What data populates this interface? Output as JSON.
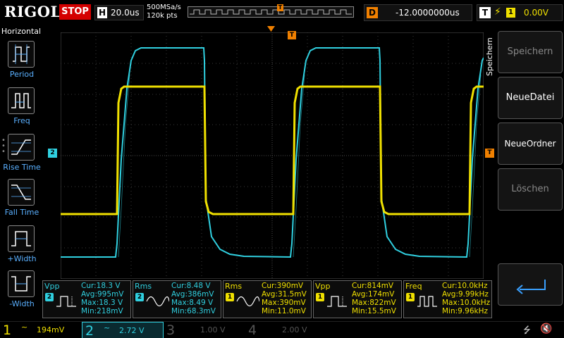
{
  "brand": "RIGOL",
  "run_state": "STOP",
  "timebase": {
    "letter": "H",
    "value": "20.0us"
  },
  "sample": {
    "rate": "500MSa/s",
    "depth": "120k pts"
  },
  "memory_trigger_label": "T",
  "delay": {
    "letter": "D",
    "value": "-12.0000000us"
  },
  "trigger": {
    "letter": "T",
    "edge": "⚡",
    "source": "1",
    "level": "0.00V"
  },
  "left_menu": {
    "title": "Horizontal",
    "items": [
      {
        "label": "Period"
      },
      {
        "label": "Freq"
      },
      {
        "label": "Rise Time"
      },
      {
        "label": "Fall Time"
      },
      {
        "label": "+Width"
      },
      {
        "label": "-Width"
      }
    ]
  },
  "right_menu": {
    "title": "Speichern",
    "buttons": [
      {
        "label": "Speichern",
        "enabled": false
      },
      {
        "label": "NeueDatei",
        "enabled": true
      },
      {
        "label": "NeueOrdner",
        "enabled": true
      },
      {
        "label": "Löschen",
        "enabled": false
      }
    ],
    "back_icon": "return-arrow-icon"
  },
  "markers": {
    "ch2": "2",
    "trigger_T": "T"
  },
  "measurements": [
    {
      "name": "Vpp",
      "src": "2",
      "cur": "Cur:18.3 V",
      "avg": "Avg:995mV",
      "max": "Max:18.3 V",
      "min": "Min:218mV",
      "color": "#30d0e0"
    },
    {
      "name": "Rms",
      "src": "2",
      "cur": "Cur:8.48 V",
      "avg": "Avg:386mV",
      "max": "Max:8.49 V",
      "min": "Min:68.3mV",
      "color": "#30d0e0"
    },
    {
      "name": "Rms",
      "src": "1",
      "cur": "Cur:390mV",
      "avg": "Avg:31.5mV",
      "max": "Max:390mV",
      "min": "Min:11.0mV",
      "color": "#f0e000"
    },
    {
      "name": "Vpp",
      "src": "1",
      "cur": "Cur:814mV",
      "avg": "Avg:174mV",
      "max": "Max:822mV",
      "min": "Min:15.5mV",
      "color": "#f0e000"
    },
    {
      "name": "Freq",
      "src": "1",
      "cur": "Cur:10.0kHz",
      "avg": "Avg:9.99kHz",
      "max": "Max:10.0kHz",
      "min": "Min:9.96kHz",
      "color": "#f0e000"
    }
  ],
  "channels": [
    {
      "num": "1",
      "coupling": "~",
      "value": "194mV",
      "color": "#f0e000",
      "active": true
    },
    {
      "num": "2",
      "coupling": "~",
      "value": "2.72 V",
      "color": "#30d0e0",
      "active": true
    },
    {
      "num": "3",
      "coupling": "",
      "value": "1.00 V",
      "color": "#555555",
      "active": false
    },
    {
      "num": "4",
      "coupling": "",
      "value": "2.00 V",
      "color": "#555555",
      "active": false
    }
  ],
  "status_icons": [
    "usb-icon",
    "speaker-muted-icon"
  ],
  "colors": {
    "ch1": "#f0e000",
    "ch2": "#30d0e0",
    "trigger": "#f08000",
    "stop": "#d40000",
    "menu_label": "#5ab0ff"
  }
}
